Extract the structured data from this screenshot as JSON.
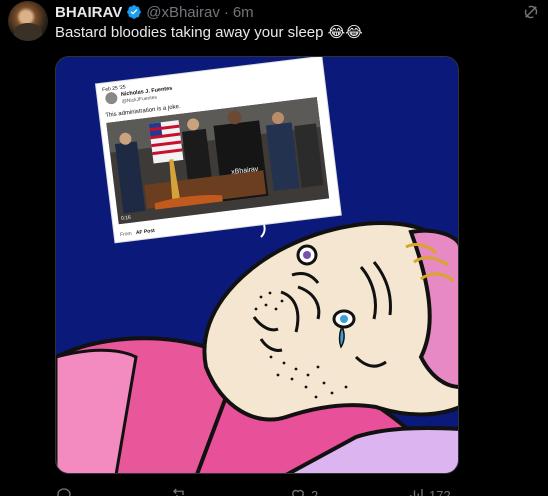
{
  "post": {
    "author": {
      "display_name": "BHAIRAV",
      "handle": "@xBhairav",
      "separator": "·",
      "time": "6m",
      "verified_color": "#1d9bf0"
    },
    "text": "Bastard bloodies taking away your sleep",
    "emoji": "😂😂",
    "icons": {
      "verified": "verified-badge-icon",
      "grok": "grok-icon"
    }
  },
  "embedded_screenshot": {
    "date": "Feb 25 '25",
    "author_name": "Nicholas J. Fuentes",
    "author_handle": "@NickJFuentes",
    "text": "This administration is a joke.",
    "watermark": "xBhairav",
    "video_time": "0:16",
    "from_label": "From",
    "source": "AF Post"
  },
  "actions": {
    "reply_count": "",
    "repost_count": "",
    "like_count": "2",
    "views_count": "172"
  },
  "colors": {
    "background": "#000000",
    "text_primary": "#e7e9ea",
    "text_secondary": "#71767b",
    "meme_background": "#0b1a7a",
    "blanket": "#ec5fa0"
  }
}
